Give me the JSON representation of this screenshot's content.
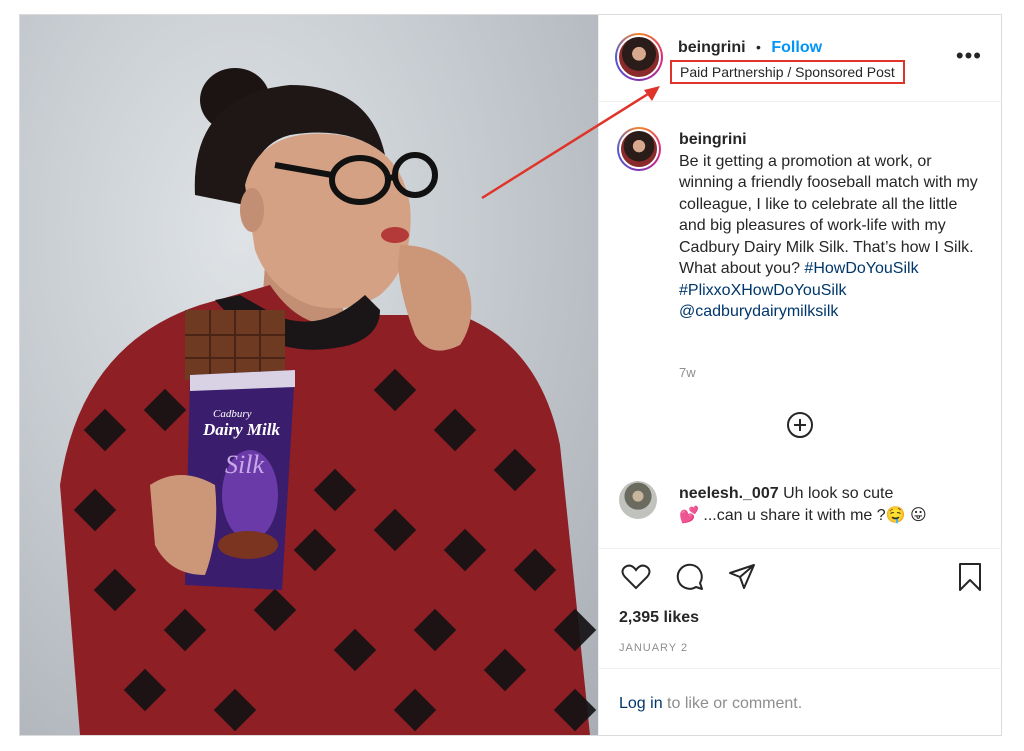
{
  "post": {
    "username": "beingrini",
    "separator": "•",
    "follow_label": "Follow",
    "sponsor_label": "Paid Partnership / Sponsored Post",
    "more_label": "•••",
    "caption_username": "beingrini",
    "caption_text": "Be it getting a promotion at work, or winning a friendly fooseball match with my colleague, I like to celebrate all the little and big pleasures of work-life with my Cadbury Dairy Milk Silk. That’s how I Silk. What about you?",
    "hashtag1": "#HowDoYouSilk",
    "hashtag2": "#PlixxoXHowDoYouSilk",
    "mention": "@cadburydairymilksilk",
    "age": "7w",
    "comment_username": "neelesh._007",
    "comment_text": "Uh look so cute",
    "comment_text2": "💕 ...can u share it with me ?🤤 😛",
    "likes": "2,395 likes",
    "date": "JANUARY 2",
    "login_link": "Log in",
    "login_rest": " to like or comment."
  },
  "icons": [
    "heart-icon",
    "comment-icon",
    "share-icon",
    "bookmark-icon",
    "add-comment-icon",
    "more-icon"
  ],
  "colors": {
    "follow": "#0095f6",
    "link": "#00376b",
    "highlight": "#e0342a",
    "muted": "#8e8e8e",
    "text": "#262626"
  },
  "photo": {
    "chocolate_brand": "Cadbury",
    "chocolate_name": "Dairy Milk",
    "chocolate_variant": "Silk"
  }
}
